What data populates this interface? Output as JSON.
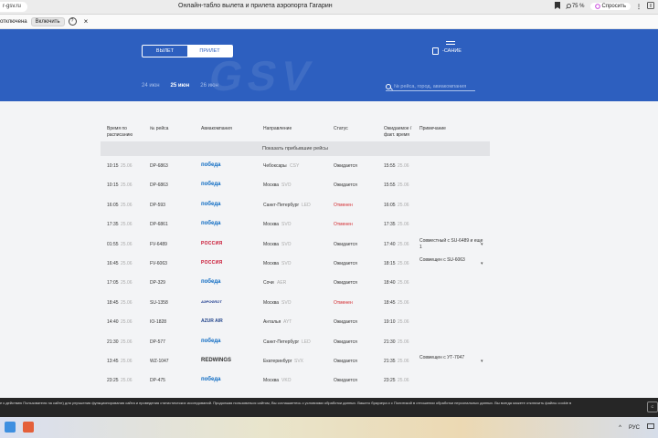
{
  "browser": {
    "url": "r-gsv.ru",
    "title": "Онлайн-табло вылета и прилета аэропорта Гагарин",
    "zoom": "75 %",
    "ask_label": "Спросить"
  },
  "notice": {
    "text": "отключена",
    "enable_label": "Включить",
    "help": "?",
    "close": "×"
  },
  "hero": {
    "watermark": "GSV",
    "tabs": {
      "departure": "ВЫЛЕТ",
      "arrival": "ПРИЛЕТ"
    },
    "menu_label": "-САНИЕ",
    "dates": [
      "24 июн",
      "25 июн",
      "26 июн"
    ],
    "active_date": "25 июн",
    "search_placeholder": "№ рейса, город, авиакомпания"
  },
  "table": {
    "headers": {
      "time": "Время по расписанию",
      "flight": "№ рейса",
      "airline": "Авиакомпания",
      "direction": "Направление",
      "status": "Статус",
      "expected": "Ожидаемое / факт. время",
      "note": "Примечание"
    },
    "show_arrived": "Показать прибывшие рейсы",
    "rows": [
      {
        "time": "10:15",
        "date": "25.06",
        "flight": "DP-6863",
        "airline": "победа",
        "airline_type": "pobeda",
        "city": "Чебоксары",
        "code": "CSY",
        "status": "Ожидается",
        "status_color": "normal",
        "exp": "15:55",
        "exp_date": "25.06",
        "note": "",
        "chevron": ""
      },
      {
        "time": "10:15",
        "date": "25.06",
        "flight": "DP-6863",
        "airline": "победа",
        "airline_type": "pobeda",
        "city": "Москва",
        "code": "SVO",
        "status": "Ожидается",
        "status_color": "normal",
        "exp": "15:55",
        "exp_date": "25.06",
        "note": "",
        "chevron": ""
      },
      {
        "time": "16:05",
        "date": "25.06",
        "flight": "DP-593",
        "airline": "победа",
        "airline_type": "pobeda",
        "city": "Санкт-Петербург",
        "code": "LED",
        "status": "Отменен",
        "status_color": "cancel",
        "exp": "16:05",
        "exp_date": "25.06",
        "note": "",
        "chevron": ""
      },
      {
        "time": "17:35",
        "date": "25.06",
        "flight": "DP-6861",
        "airline": "победа",
        "airline_type": "pobeda",
        "city": "Москва",
        "code": "SVO",
        "status": "Отменен",
        "status_color": "cancel",
        "exp": "17:35",
        "exp_date": "25.06",
        "note": "",
        "chevron": ""
      },
      {
        "time": "01:55",
        "date": "25.06",
        "flight": "FV-6489",
        "airline": "РОССИЯ",
        "airline_type": "rossiya",
        "city": "Москва",
        "code": "SVO",
        "status": "Ожидается",
        "status_color": "normal",
        "exp": "17:40",
        "exp_date": "25.06",
        "note": "Совместный с SU-6489 и еще 1",
        "chevron": "▾"
      },
      {
        "time": "16:45",
        "date": "25.06",
        "flight": "FV-6063",
        "airline": "РОССИЯ",
        "airline_type": "rossiya",
        "city": "Москва",
        "code": "SVO",
        "status": "Ожидается",
        "status_color": "normal",
        "exp": "18:15",
        "exp_date": "25.06",
        "note": "Совмещен с SU-6063",
        "chevron": "▾"
      },
      {
        "time": "17:05",
        "date": "25.06",
        "flight": "DP-329",
        "airline": "победа",
        "airline_type": "pobeda",
        "city": "Сочи",
        "code": "AER",
        "status": "Ожидается",
        "status_color": "normal",
        "exp": "18:40",
        "exp_date": "25.06",
        "note": "",
        "chevron": ""
      },
      {
        "time": "18:45",
        "date": "25.06",
        "flight": "SU-1358",
        "airline": "АЭРОФЛОТ",
        "airline_type": "aeroflot",
        "city": "Москва",
        "code": "SVO",
        "status": "Отменен",
        "status_color": "cancel",
        "exp": "18:45",
        "exp_date": "25.06",
        "note": "",
        "chevron": ""
      },
      {
        "time": "14:40",
        "date": "25.06",
        "flight": "IO-1828",
        "airline": "AZUR AIR",
        "airline_type": "azur",
        "city": "Анталья",
        "code": "AYT",
        "status": "Ожидается",
        "status_color": "normal",
        "exp": "19:10",
        "exp_date": "25.06",
        "note": "",
        "chevron": ""
      },
      {
        "time": "21:30",
        "date": "25.06",
        "flight": "DP-577",
        "airline": "победа",
        "airline_type": "pobeda",
        "city": "Санкт-Петербург",
        "code": "LED",
        "status": "Ожидается",
        "status_color": "normal",
        "exp": "21:30",
        "exp_date": "25.06",
        "note": "",
        "chevron": ""
      },
      {
        "time": "13:45",
        "date": "25.06",
        "flight": "WZ-1047",
        "airline": "REDWINGS",
        "airline_type": "redwings",
        "city": "Екатеринбург",
        "code": "SVX",
        "status": "Ожидается",
        "status_color": "normal",
        "exp": "21:35",
        "exp_date": "25.06",
        "note": "Совмещен с УТ-7047",
        "chevron": "▾"
      },
      {
        "time": "23:25",
        "date": "25.06",
        "flight": "DP-475",
        "airline": "победа",
        "airline_type": "pobeda",
        "city": "Москва",
        "code": "VKO",
        "status": "Ожидается",
        "status_color": "normal",
        "exp": "23:25",
        "exp_date": "25.06",
        "note": "",
        "chevron": ""
      }
    ]
  },
  "cookie": {
    "text": "е к действию Пользователя на сайте) для улучшения функционирования сайта и проведения статистических исследований. Продолжая пользоваться сайтом, Вы соглашаетесь с условиями обработки данных. Вашего браузера и с Политикой в отношении обработки персональных данных. Вы всегда можете отключить файлы cookie в",
    "button": "C"
  },
  "taskbar": {
    "lang": "РУС",
    "chevron_up": "^"
  }
}
